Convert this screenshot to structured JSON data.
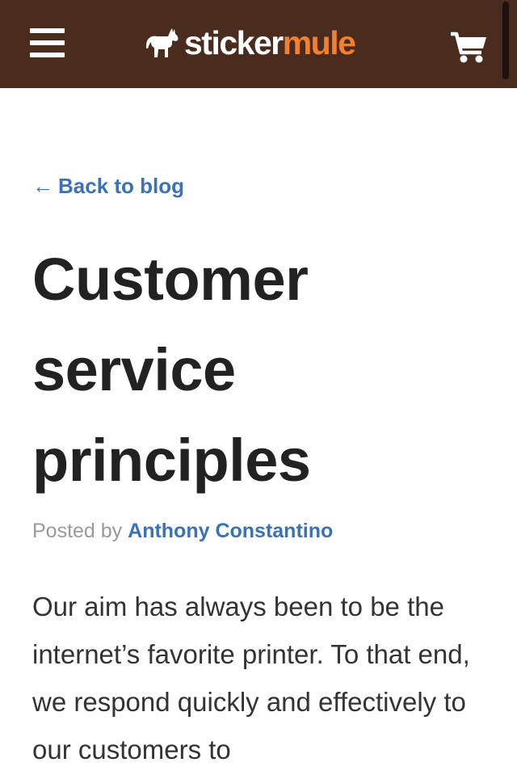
{
  "header": {
    "logo_word1": "sticker",
    "logo_word2": "mule",
    "background": "#4a2c1e",
    "accent": "#f47f2e",
    "menu_icon": "hamburger-menu-icon",
    "cart_icon": "shopping-cart-icon"
  },
  "article": {
    "back_arrow": "←",
    "back_label": "Back to blog",
    "title": "Customer service principles",
    "byline_prefix": "Posted by",
    "author": "Anthony Constantino",
    "body": "Our aim has always been to be the internet’s favorite printer. To that end, we respond quickly and effectively to our customers to",
    "link_color": "#3b72b5"
  }
}
